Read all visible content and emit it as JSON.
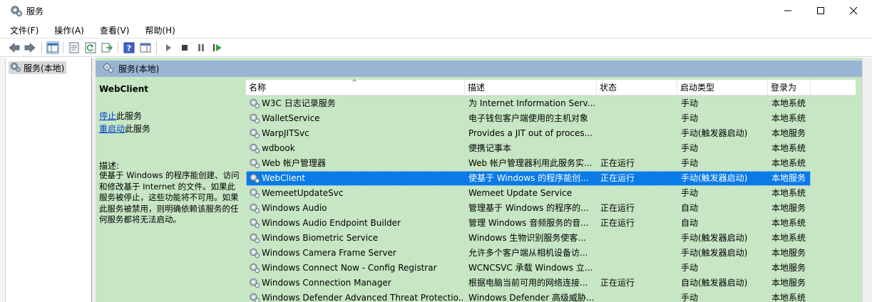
{
  "window": {
    "title": "服务"
  },
  "menu": [
    {
      "label": "文件(F)"
    },
    {
      "label": "操作(A)"
    },
    {
      "label": "查看(V)"
    },
    {
      "label": "帮助(H)"
    }
  ],
  "tree": {
    "item_label": "服务(本地)"
  },
  "main": {
    "header_label": "服务(本地)",
    "selected_service": "WebClient",
    "stop_link": "停止",
    "stop_suffix": "此服务",
    "restart_link": "重启动",
    "restart_suffix": "此服务",
    "desc_label": "描述:",
    "desc_text": "使基于 Windows 的程序能创建、访问和修改基于 Internet 的文件。如果此服务被停止，这些功能将不可用。如果此服务被禁用，则明确依赖该服务的任何服务都将无法启动。"
  },
  "table": {
    "columns": [
      "名称",
      "描述",
      "状态",
      "启动类型",
      "登录为"
    ],
    "rows": [
      {
        "name": "W3C 日志记录服务",
        "desc": "为 Internet Information Serv...",
        "status": "",
        "start": "手动",
        "logon": "本地系统"
      },
      {
        "name": "WalletService",
        "desc": "电子钱包客户端使用的主机对象",
        "status": "",
        "start": "手动",
        "logon": "本地系统"
      },
      {
        "name": "WarpJITSvc",
        "desc": "Provides a JIT out of proces...",
        "status": "",
        "start": "手动(触发器启动)",
        "logon": "本地服务"
      },
      {
        "name": "wdbook",
        "desc": "便携记事本",
        "status": "",
        "start": "手动",
        "logon": "本地系统"
      },
      {
        "name": "Web 帐户管理器",
        "desc": "Web 帐户管理器利用此服务实...",
        "status": "正在运行",
        "start": "手动",
        "logon": "本地系统"
      },
      {
        "name": "WebClient",
        "desc": "使基于 Windows 的程序能创...",
        "status": "正在运行",
        "start": "手动(触发器启动)",
        "logon": "本地服务",
        "selected": true
      },
      {
        "name": "WemeetUpdateSvc",
        "desc": "Wemeet Update Service",
        "status": "",
        "start": "手动",
        "logon": "本地系统"
      },
      {
        "name": "Windows Audio",
        "desc": "管理基于 Windows 的程序的...",
        "status": "正在运行",
        "start": "自动",
        "logon": "本地服务"
      },
      {
        "name": "Windows Audio Endpoint Builder",
        "desc": "管理 Windows 音频服务的音...",
        "status": "正在运行",
        "start": "自动",
        "logon": "本地系统"
      },
      {
        "name": "Windows Biometric Service",
        "desc": "Windows 生物识别服务使客...",
        "status": "",
        "start": "手动(触发器启动)",
        "logon": "本地系统"
      },
      {
        "name": "Windows Camera Frame Server",
        "desc": "允许多个客户端从相机设备访...",
        "status": "",
        "start": "手动(触发器启动)",
        "logon": "本地服务"
      },
      {
        "name": "Windows Connect Now - Config Registrar",
        "desc": "WCNCSVC 承载 Windows 立...",
        "status": "",
        "start": "手动",
        "logon": "本地服务"
      },
      {
        "name": "Windows Connection Manager",
        "desc": "根据电脑当前可用的网络连接...",
        "status": "正在运行",
        "start": "自动(触发器启动)",
        "logon": "本地服务"
      },
      {
        "name": "Windows Defender Advanced Threat Protectio...",
        "desc": "Windows Defender 高级威胁...",
        "status": "",
        "start": "手动",
        "logon": "本地系统"
      }
    ]
  },
  "colors": {
    "pane_green": "#c7e6c4",
    "header_blue": "#9ab5d4",
    "selection": "#0a7ae6",
    "link": "#0044cc"
  },
  "icons": [
    "services-app-icon",
    "gear-service-icon",
    "back-arrow-icon",
    "forward-arrow-icon",
    "play-icon",
    "stop-icon",
    "pause-icon",
    "resume-icon",
    "help-icon"
  ]
}
